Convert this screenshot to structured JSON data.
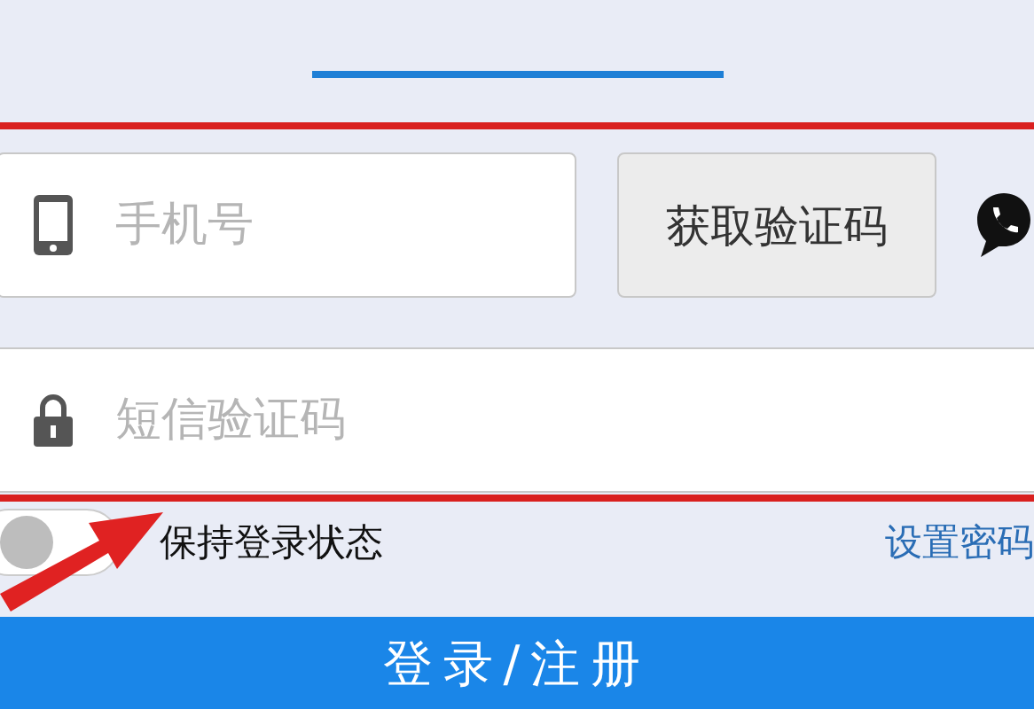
{
  "phone_field": {
    "placeholder": "手机号"
  },
  "code_button": {
    "label": "获取验证码"
  },
  "sms_field": {
    "placeholder": "短信验证码"
  },
  "keep_login": {
    "label": "保持登录状态",
    "on": false
  },
  "set_password_link": {
    "label": "设置密码"
  },
  "submit_button": {
    "label": "登录/注册"
  }
}
